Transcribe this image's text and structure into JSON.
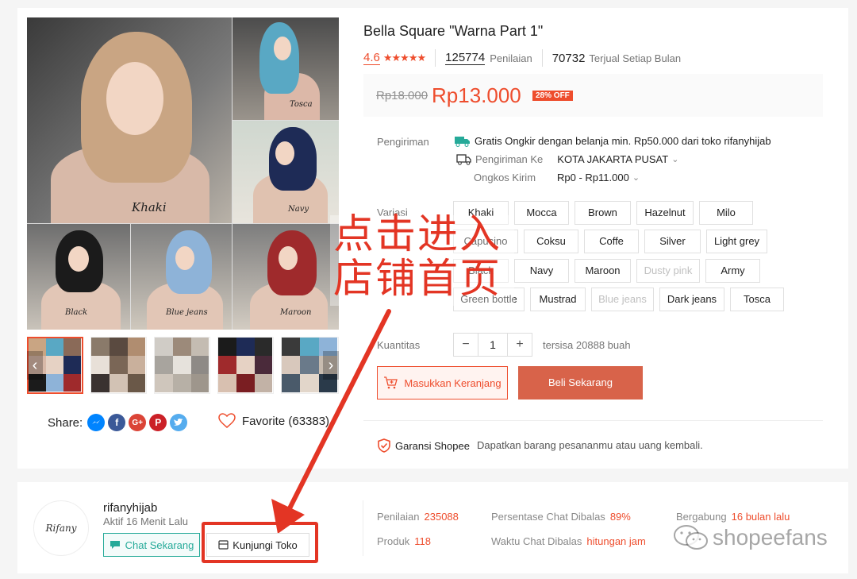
{
  "product": {
    "title": "Bella Square \"Warna Part 1\"",
    "rating": "4.6",
    "stars": "★★★★★",
    "review_count": "125774",
    "review_label": "Penilaian",
    "sold_count": "70732",
    "sold_label": "Terjual Setiap Bulan",
    "old_price": "Rp18.000",
    "price": "Rp13.000",
    "discount": "28% OFF"
  },
  "gallery": {
    "captions": [
      "Khaki",
      "Tosca",
      "Navy",
      "Black",
      "Blue jeans",
      "Maroon"
    ],
    "prev_arrow": "‹",
    "next_arrow": "›"
  },
  "shipping": {
    "label": "Pengiriman",
    "free_text": "Gratis Ongkir dengan belanja min. Rp50.000 dari toko rifanyhijab",
    "to_label": "Pengiriman Ke",
    "to_value": "KOTA JAKARTA PUSAT",
    "cost_label": "Ongkos Kirim",
    "cost_value": "Rp0 - Rp11.000"
  },
  "variants": {
    "label": "Variasi",
    "options": [
      "Khaki",
      "Mocca",
      "Brown",
      "Hazelnut",
      "Milo",
      "Capucino",
      "Coksu",
      "Coffe",
      "Silver",
      "Light grey",
      "Black",
      "Navy",
      "Maroon",
      "Dusty pink",
      "Army",
      "Green bottle",
      "Mustrad",
      "Blue jeans",
      "Dark jeans",
      "Tosca"
    ]
  },
  "quantity": {
    "label": "Kuantitas",
    "minus": "−",
    "value": "1",
    "plus": "+",
    "stock": "tersisa 20888 buah"
  },
  "actions": {
    "cart": "Masukkan Keranjang",
    "buy": "Beli Sekarang"
  },
  "guarantee": {
    "label": "Garansi Shopee",
    "desc": "Dapatkan barang pesananmu atau uang kembali."
  },
  "share": {
    "label": "Share:",
    "favorite": "Favorite (63383)"
  },
  "overlay": {
    "line1": "点击进入",
    "line2": "店铺首页"
  },
  "shop": {
    "logo_text": "Rifany",
    "name": "rifanyhijab",
    "active": "Aktif 16 Menit Lalu",
    "chat_btn": "Chat Sekarang",
    "visit_btn": "Kunjungi Toko",
    "stats": {
      "rating_label": "Penilaian",
      "rating_value": "235088",
      "product_label": "Produk",
      "product_value": "118",
      "chat_pct_label": "Persentase Chat Dibalas",
      "chat_pct_value": "89%",
      "chat_time_label": "Waktu Chat Dibalas",
      "chat_time_value": "hitungan jam",
      "joined_label": "Bergabung",
      "joined_value": "16 bulan lalu"
    }
  },
  "watermark": "shopeefans",
  "colors": {
    "accent": "#ee4d2d",
    "annotation": "#e33524",
    "chat": "#26aa99"
  }
}
